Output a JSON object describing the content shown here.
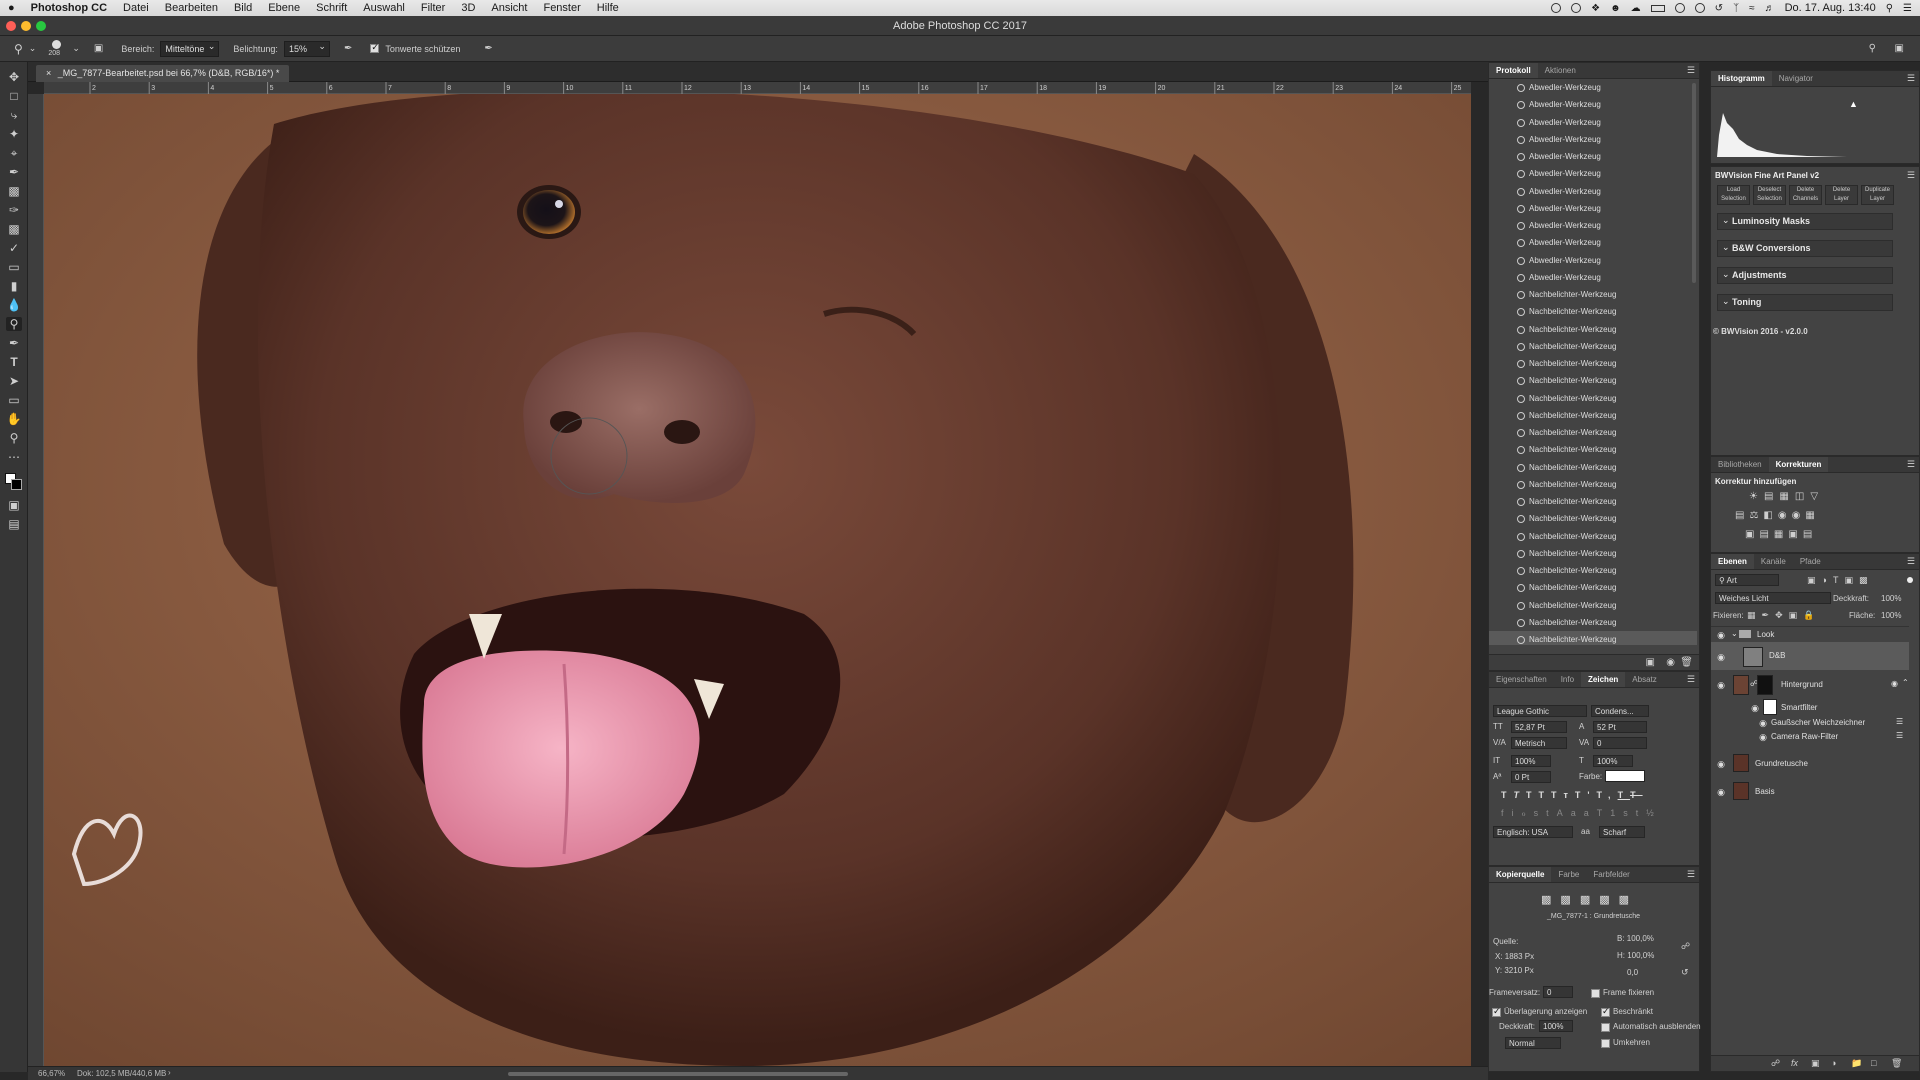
{
  "menubar": {
    "apple": "",
    "app": "Photoshop CC",
    "items": [
      "Datei",
      "Bearbeiten",
      "Bild",
      "Ebene",
      "Schrift",
      "Auswahl",
      "Filter",
      "3D",
      "Ansicht",
      "Fenster",
      "Hilfe"
    ],
    "clock": "Do. 17. Aug.  13:40"
  },
  "window": {
    "title": "Adobe Photoshop CC 2017"
  },
  "options": {
    "brush_size": "208",
    "range_label": "Bereich:",
    "range_value": "Mitteltöne",
    "exposure_label": "Belichtung:",
    "exposure_value": "15%",
    "protect_tones": "Tonwerte schützen"
  },
  "document": {
    "tab": "_MG_7877-Bearbeitet.psd bei 66,7% (D&B, RGB/16*) *",
    "ruler_ticks": [
      "2",
      "3",
      "4",
      "5",
      "6",
      "7",
      "8",
      "9",
      "10",
      "11",
      "12",
      "13",
      "14",
      "15",
      "16",
      "17",
      "18",
      "19",
      "20",
      "21",
      "22",
      "23",
      "24",
      "25"
    ],
    "zoom": "66,67%",
    "doc_info": "Dok: 102,5 MB/440,6 MB"
  },
  "history": {
    "tabs": [
      "Protokoll",
      "Aktionen"
    ],
    "items": [
      "Abwedler-Werkzeug",
      "Abwedler-Werkzeug",
      "Abwedler-Werkzeug",
      "Abwedler-Werkzeug",
      "Abwedler-Werkzeug",
      "Abwedler-Werkzeug",
      "Abwedler-Werkzeug",
      "Abwedler-Werkzeug",
      "Abwedler-Werkzeug",
      "Abwedler-Werkzeug",
      "Abwedler-Werkzeug",
      "Abwedler-Werkzeug",
      "Nachbelichter-Werkzeug",
      "Nachbelichter-Werkzeug",
      "Nachbelichter-Werkzeug",
      "Nachbelichter-Werkzeug",
      "Nachbelichter-Werkzeug",
      "Nachbelichter-Werkzeug",
      "Nachbelichter-Werkzeug",
      "Nachbelichter-Werkzeug",
      "Nachbelichter-Werkzeug",
      "Nachbelichter-Werkzeug",
      "Nachbelichter-Werkzeug",
      "Nachbelichter-Werkzeug",
      "Nachbelichter-Werkzeug",
      "Nachbelichter-Werkzeug",
      "Nachbelichter-Werkzeug",
      "Nachbelichter-Werkzeug",
      "Nachbelichter-Werkzeug",
      "Nachbelichter-Werkzeug",
      "Nachbelichter-Werkzeug",
      "Nachbelichter-Werkzeug",
      "Nachbelichter-Werkzeug"
    ]
  },
  "character": {
    "tabs": [
      "Eigenschaften",
      "Info",
      "Zeichen",
      "Absatz"
    ],
    "font": "League Gothic",
    "style": "Condens...",
    "size": "52,87 Pt",
    "leading": "52 Pt",
    "kerning": "Metrisch",
    "tracking": "0",
    "vscale": "100%",
    "hscale": "100%",
    "baseline": "0 Pt",
    "color_label": "Farbe:",
    "language": "Englisch: USA",
    "antialias": "Scharf"
  },
  "clone": {
    "tabs": [
      "Kopierquelle",
      "Farbe",
      "Farbfelder"
    ],
    "source_name": "_MG_7877-1 : Grundretusche",
    "source_label": "Quelle:",
    "x": "X:  1883 Px",
    "y": "Y:  3210 Px",
    "w": "B:  100,0%",
    "h": "H:  100,0%",
    "angle": "0,0",
    "frame_offset_label": "Frameversatz:",
    "frame_offset": "0",
    "lock_frame": "Frame fixieren",
    "show_overlay": "Überlagerung anzeigen",
    "opacity_label": "Deckkraft:",
    "opacity": "100%",
    "mode": "Normal",
    "clipped": "Beschränkt",
    "auto_hide": "Automatisch ausblenden",
    "invert": "Umkehren"
  },
  "histogram": {
    "tabs": [
      "Histogramm",
      "Navigator"
    ]
  },
  "bwvision": {
    "title": "BWVision Fine Art Panel v2",
    "buttons": [
      {
        "l1": "Load",
        "l2": "Selection"
      },
      {
        "l1": "Deselect",
        "l2": "Selection"
      },
      {
        "l1": "Delete",
        "l2": "Channels"
      },
      {
        "l1": "Delete",
        "l2": "Layer"
      },
      {
        "l1": "Duplicate",
        "l2": "Layer"
      }
    ],
    "sections": [
      "Luminosity Masks",
      "B&W Conversions",
      "Adjustments",
      "Toning"
    ],
    "footer": "© BWVision 2016 - v2.0.0"
  },
  "adjustments": {
    "tabs": [
      "Bibliotheken",
      "Korrekturen"
    ],
    "heading": "Korrektur hinzufügen"
  },
  "layers": {
    "tabs": [
      "Ebenen",
      "Kanäle",
      "Pfade"
    ],
    "filter": "Art",
    "blend_mode": "Weiches Licht",
    "opacity_label": "Deckkraft:",
    "opacity": "100%",
    "lock_label": "Fixieren:",
    "fill_label": "Fläche:",
    "fill": "100%",
    "items": [
      "Look",
      "D&B",
      "Hintergrund",
      "Smartfilter",
      "Gaußscher Weichzeichner",
      "Camera Raw-Filter",
      "Grundretusche",
      "Basis"
    ]
  }
}
